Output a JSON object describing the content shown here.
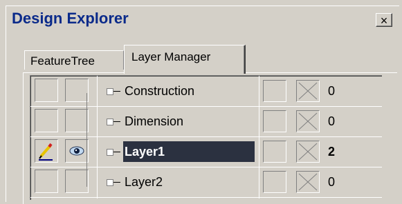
{
  "window": {
    "title": "Design Explorer",
    "close_label": "×"
  },
  "tabs": [
    {
      "label": "FeatureTree",
      "active": false
    },
    {
      "label": "Layer Manager",
      "active": true
    }
  ],
  "layers": [
    {
      "name": "Construction",
      "count": "0",
      "selected": false,
      "edit_icon": false,
      "visible_icon": false
    },
    {
      "name": "Dimension",
      "count": "0",
      "selected": false,
      "edit_icon": false,
      "visible_icon": false
    },
    {
      "name": "Layer1",
      "count": "2",
      "selected": true,
      "edit_icon": true,
      "visible_icon": true
    },
    {
      "name": "Layer2",
      "count": "0",
      "selected": false,
      "edit_icon": false,
      "visible_icon": false
    }
  ],
  "colors": {
    "title": "#0a2a8a",
    "selection": "#2b3140",
    "face": "#d4d0c8"
  },
  "icons": {
    "edit": "pencil-icon",
    "visible": "eye-icon",
    "lock": "x-box-icon"
  }
}
